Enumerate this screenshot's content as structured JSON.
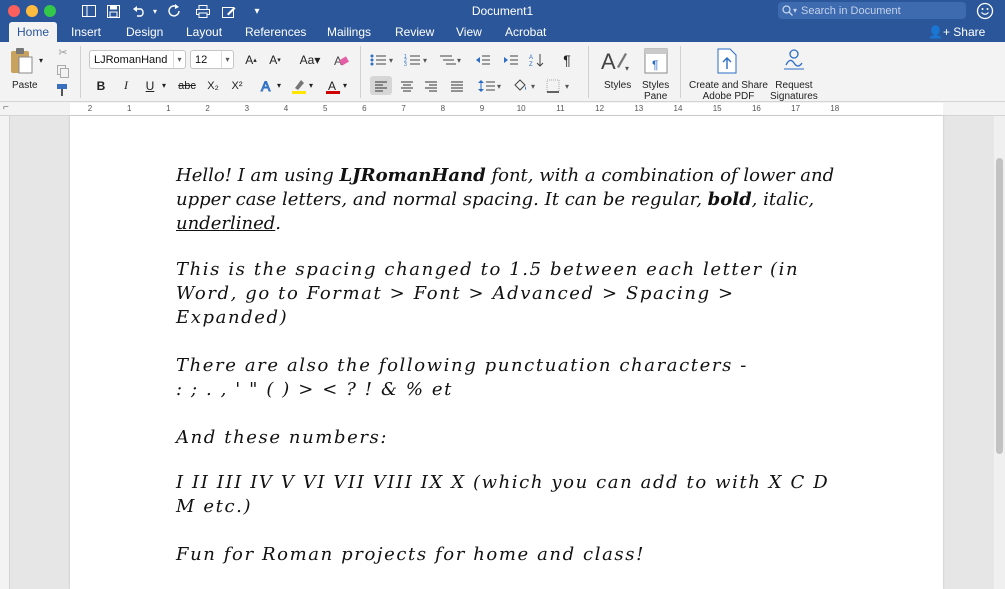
{
  "window": {
    "title": "Document1",
    "search_placeholder": "Search in Document"
  },
  "tabs": [
    {
      "label": "Home"
    },
    {
      "label": "Insert"
    },
    {
      "label": "Design"
    },
    {
      "label": "Layout"
    },
    {
      "label": "References"
    },
    {
      "label": "Mailings"
    },
    {
      "label": "Review"
    },
    {
      "label": "View"
    },
    {
      "label": "Acrobat"
    }
  ],
  "share_label": "Share",
  "ribbon": {
    "paste_label": "Paste",
    "font_name": "LJRomanHand",
    "font_size": "12",
    "bold": "B",
    "italic": "I",
    "underline": "U",
    "strike": "abc",
    "subscript": "X₂",
    "superscript": "X²",
    "styles_label": "Styles",
    "styles_pane_label": [
      "Styles",
      "Pane"
    ],
    "create_pdf_label": [
      "Create and Share",
      "Adobe PDF"
    ],
    "request_sig_label": [
      "Request",
      "Signatures"
    ],
    "font_color": "#d00000",
    "highlight_color": "#ffe600"
  },
  "ruler": {
    "numbers": [
      "2",
      "1",
      "1",
      "2",
      "3",
      "4",
      "5",
      "6",
      "7",
      "8",
      "9",
      "10",
      "11",
      "12",
      "13",
      "14",
      "15",
      "16",
      "17",
      "18"
    ]
  },
  "document": {
    "p1": {
      "a": "Hello! I am using ",
      "bold": "LJRomanHand",
      "b": " font, with a combination of lower and upper case letters, and normal spacing. It can be regular, ",
      "bold2": "bold",
      "c": ", italic, ",
      "underline": "underlined",
      "d": "."
    },
    "p2": "This is the spacing changed to 1.5 between each letter (in Word, go to Format > Font > Advanced > Spacing > Expanded)",
    "p3_line1": "There are also the following punctuation characters -",
    "p3_line2": ": ; . , ' \" ( ) > < ? ! & % et",
    "p4": "And these numbers:",
    "p5": "I  II  III  IV  V  VI  VII  VIII  IX  X  (which you can add to with X C D M etc.)",
    "p6": "Fun for Roman projects for home and class!"
  },
  "colors": {
    "accent": "#2b579a",
    "ribbon_bg": "#f3f3f3",
    "canvas_bg": "#e6e6e6"
  }
}
